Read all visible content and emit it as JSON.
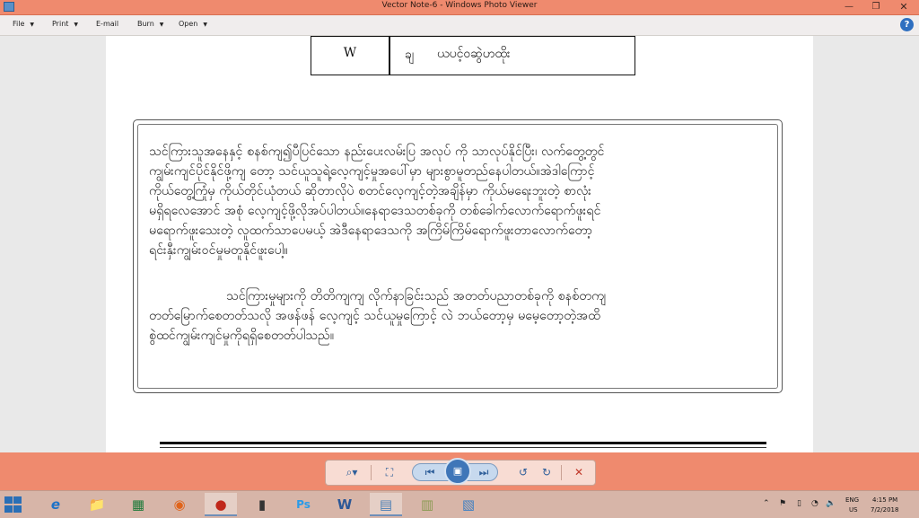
{
  "window": {
    "title": "Vector Note-6 - Windows Photo Viewer",
    "minimize_glyph": "—",
    "restore_glyph": "❐",
    "close_glyph": "✕"
  },
  "menu": {
    "items": [
      {
        "label": "File"
      },
      {
        "label": "Print"
      },
      {
        "label": "E-mail"
      },
      {
        "label": "Burn"
      },
      {
        "label": "Open"
      }
    ],
    "arrow_glyph": "▼",
    "help_glyph": "?"
  },
  "document": {
    "table": {
      "row_key": "W",
      "row_symbol": "ချ",
      "row_value": "ယပင့်ဝဆွဲဟထိုး"
    },
    "paragraph1": [
      "သင်ကြားသူအနေနှင့် စနစ်ကျ၍ပီပြင်သော နည်းပေးလမ်းပြ အလုပ် ကို သာလုပ်နိုင်ပြီး၊ လက်တွေ့တွင်",
      "ကျွမ်းကျင်ပိုင်နိုင်ဖို့ကျ တော့ သင်ယူသူရဲ့လေ့ကျင့်မှုအပေါ်မှာ များစွာမူတည်နေပါတယ်။အဲဒါကြောင့်",
      "ကိုယ်တွေ့ကြုံမှ ကိုယ်တိုင်ယုံတယ် ဆိုတာလိုပဲ စတင်လေ့ကျင့်တဲ့အချိန်မှာ ကိုယ်မရေးဘူးတဲ့ စာလုံး",
      "မရှိရလေအောင် အစုံ လေ့ကျင့်ဖို့လိုအပ်ပါတယ်။နေရာဒေသတစ်ခုကို တစ်ခေါက်လောက်ရောက်ဖူးရင်",
      "မရောက်ဖူးသေးတဲ့ လူထက်သာပေမယ့် အဲဒီနေရာဒေသကို အကြိမ်ကြိမ်ရောက်ဖူးတာလောက်တော့",
      "ရင်းနှီးကျွမ်းဝင်မှုမတူနိုင်ဖူးပေါ့။"
    ],
    "paragraph2": [
      "သင်ကြားမှုများကို တိတိကျကျ လိုက်နာခြင်းသည် အတတ်ပညာတစ်ခုကို စနစ်တကျ",
      "တတ်မြောက်စေတတ်သလို   အဖန်ဖန် လေ့ကျင့် သင်ယူမှုကြောင့် လဲ ဘယ်တော့မှ မမေ့တော့တဲ့အထိ",
      "စွဲထင်ကျွမ်းကျင်မှုကိုရရှိစေတတ်ပါသည်။"
    ]
  },
  "controls": {
    "zoom_glyph": "⌕▾",
    "actual_size_glyph": "⛶",
    "previous_glyph": "⏮",
    "slideshow_glyph": "▣",
    "next_glyph": "⏭",
    "rotate_ccw_glyph": "↺",
    "rotate_cw_glyph": "↻",
    "delete_glyph": "✕"
  },
  "taskbar": {
    "items": [
      {
        "name": "internet-explorer",
        "glyph": "e"
      },
      {
        "name": "file-explorer",
        "glyph": "📁"
      },
      {
        "name": "spreadsheet-app",
        "glyph": "▦"
      },
      {
        "name": "firefox",
        "glyph": "◉"
      },
      {
        "name": "recorder-app",
        "glyph": "●"
      },
      {
        "name": "app-tool",
        "glyph": "▮"
      },
      {
        "name": "photoshop",
        "glyph": "Ps"
      },
      {
        "name": "word",
        "glyph": "W"
      },
      {
        "name": "photo-viewer",
        "glyph": "▤"
      },
      {
        "name": "notes-app",
        "glyph": "▥"
      },
      {
        "name": "image-app",
        "glyph": "▧"
      }
    ],
    "lang_top": "ENG",
    "lang_bottom": "US",
    "time": "4:15 PM",
    "date": "7/2/2018"
  },
  "colors": {
    "chrome": "#ef8a6e",
    "taskbar": "#d7b5a8"
  }
}
